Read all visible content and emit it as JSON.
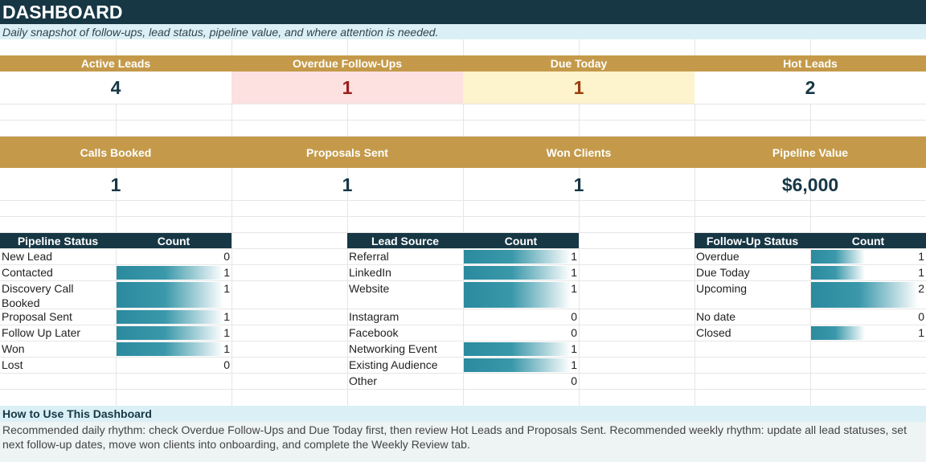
{
  "title": "DASHBOARD",
  "subtitle": "Daily snapshot of follow-ups, lead status, pipeline value, and where attention is needed.",
  "kpis_row1": [
    {
      "label": "Active Leads",
      "value": "4",
      "bg": "#ffffff",
      "color": "#173745"
    },
    {
      "label": "Overdue Follow-Ups",
      "value": "1",
      "bg": "#fde0e0",
      "color": "#9b1c1c"
    },
    {
      "label": "Due Today",
      "value": "1",
      "bg": "#fdf3cd",
      "color": "#9a3d0b"
    },
    {
      "label": "Hot Leads",
      "value": "2",
      "bg": "#ffffff",
      "color": "#173745"
    }
  ],
  "kpis_row2": [
    {
      "label": "Calls Booked",
      "value": "1"
    },
    {
      "label": "Proposals Sent",
      "value": "1"
    },
    {
      "label": "Won Clients",
      "value": "1"
    },
    {
      "label": "Pipeline Value",
      "value": "$6,000"
    }
  ],
  "pipeline_status": {
    "headers": [
      "Pipeline Status",
      "Count"
    ],
    "rows": [
      {
        "label": "New Lead",
        "count": 0
      },
      {
        "label": "Contacted",
        "count": 1
      },
      {
        "label": "Discovery Call Booked",
        "count": 1
      },
      {
        "label": "Proposal Sent",
        "count": 1
      },
      {
        "label": "Follow Up Later",
        "count": 1
      },
      {
        "label": "Won",
        "count": 1
      },
      {
        "label": "Lost",
        "count": 0
      }
    ]
  },
  "lead_source": {
    "headers": [
      "Lead Source",
      "Count"
    ],
    "rows": [
      {
        "label": "Referral",
        "count": 1
      },
      {
        "label": "LinkedIn",
        "count": 1
      },
      {
        "label": "Website",
        "count": 1
      },
      {
        "label": "Instagram",
        "count": 0
      },
      {
        "label": "Facebook",
        "count": 0
      },
      {
        "label": "Networking Event",
        "count": 1
      },
      {
        "label": "Existing Audience",
        "count": 1
      },
      {
        "label": "Other",
        "count": 0
      }
    ]
  },
  "followup_status": {
    "headers": [
      "Follow-Up Status",
      "Count"
    ],
    "rows": [
      {
        "label": "Overdue",
        "count": 1
      },
      {
        "label": "Due Today",
        "count": 1
      },
      {
        "label": "Upcoming",
        "count": 2
      },
      {
        "label": "No date",
        "count": 0
      },
      {
        "label": "Closed",
        "count": 1
      }
    ]
  },
  "howto": {
    "title": "How to Use This Dashboard",
    "body": "Recommended daily rhythm: check Overdue Follow-Ups and Due Today first, then review Hot Leads and Proposals Sent. Recommended weekly rhythm: update all lead statuses, set next follow-up dates, move won clients into onboarding, and complete the Weekly Review tab."
  }
}
